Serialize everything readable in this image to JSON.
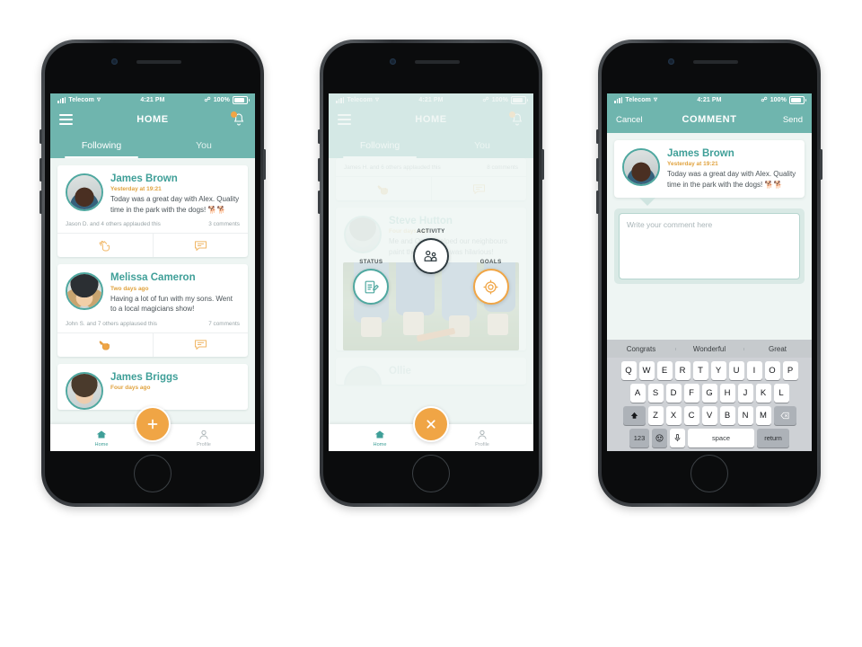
{
  "colors": {
    "teal": "#6fb5ae",
    "teal_dark": "#3f9f98",
    "orange": "#f0a545",
    "bg": "#eef5f3",
    "text": "#4a5358"
  },
  "status_bar": {
    "carrier": "Telecom",
    "time": "4:21 PM",
    "battery_pct": "100%",
    "signal_icon": "signal-bars-icon",
    "wifi_icon": "wifi-icon",
    "bluetooth_icon": "bluetooth-icon",
    "battery_icon": "battery-icon"
  },
  "phone1": {
    "nav": {
      "title": "HOME",
      "menu_icon": "hamburger-menu-icon",
      "bell_icon": "notification-bell-icon"
    },
    "tabs": [
      {
        "label": "Following",
        "active": true
      },
      {
        "label": "You",
        "active": false
      }
    ],
    "posts": [
      {
        "author": "James Brown",
        "time": "Yesterday at 19:21",
        "text": "Today was a great day with Alex. Quality time in the park with the dogs! 🐕🐕",
        "applause": "Jason D. and 4 others applauded this",
        "comments": "3 comments",
        "applaud_icon": "clapping-hands-icon",
        "comment_icon": "speech-bubble-icon"
      },
      {
        "author": "Melissa Cameron",
        "time": "Two days ago",
        "text": "Having a lot of fun with my sons. Went to a local magicians show!",
        "applause": "John S. and 7 others applaused this",
        "comments": "7 comments",
        "applaud_icon": "clapping-hands-icon",
        "comment_icon": "speech-bubble-icon"
      },
      {
        "author": "James Briggs",
        "time": "Four days ago",
        "text": "",
        "applause": "",
        "comments": "",
        "applaud_icon": "clapping-hands-icon",
        "comment_icon": "speech-bubble-icon"
      }
    ],
    "tabbar": {
      "home_label": "Home",
      "home_icon": "home-icon",
      "profile_label": "Profile",
      "profile_icon": "person-icon",
      "fab_icon": "plus-icon"
    }
  },
  "phone2": {
    "nav": {
      "title": "HOME",
      "menu_icon": "hamburger-menu-icon",
      "bell_icon": "notification-bell-icon"
    },
    "tabs": [
      {
        "label": "Following",
        "active": true
      },
      {
        "label": "You",
        "active": false
      }
    ],
    "top_post": {
      "applause": "James H. and 6 others applauded this",
      "comments": "8 comments",
      "applaud_icon": "clapping-hands-icon",
      "comment_icon": "speech-bubble-icon"
    },
    "post": {
      "author": "Steve Hutton",
      "time": "Four days ago",
      "text": "Me and Oscar helped our neighbours paint their fence. It was hilarious!"
    },
    "bottom_post_author": "Ollie",
    "action_menu": [
      {
        "label": "STATUS",
        "icon": "pencil-note-icon",
        "color": "#4fa8a0"
      },
      {
        "label": "ACTIVITY",
        "icon": "people-group-icon",
        "color": "#2f3b40"
      },
      {
        "label": "GOALS",
        "icon": "target-icon",
        "color": "#f0a545"
      }
    ],
    "tabbar": {
      "home_label": "Home",
      "home_icon": "home-icon",
      "profile_label": "Profile",
      "profile_icon": "person-icon",
      "fab_icon": "close-x-icon"
    }
  },
  "phone3": {
    "nav": {
      "cancel_label": "Cancel",
      "title": "COMMENT",
      "send_label": "Send"
    },
    "post": {
      "author": "James Brown",
      "time": "Yesterday at 19:21",
      "text": "Today was a great day with Alex. Quality time in the park with the dogs! 🐕🐕"
    },
    "comment_input": {
      "placeholder": "Write your comment here",
      "value": ""
    },
    "suggestions": [
      "Congrats",
      "Wonderful",
      "Great"
    ],
    "keyboard": {
      "row1": [
        "Q",
        "W",
        "E",
        "R",
        "T",
        "Y",
        "U",
        "I",
        "O",
        "P"
      ],
      "row2": [
        "A",
        "S",
        "D",
        "F",
        "G",
        "H",
        "J",
        "K",
        "L"
      ],
      "row3": [
        "Z",
        "X",
        "C",
        "V",
        "B",
        "N",
        "M"
      ],
      "shift_icon": "shift-arrow-icon",
      "backspace_icon": "backspace-icon",
      "numbers_label": "123",
      "emoji_icon": "smiley-face-icon",
      "mic_icon": "microphone-icon",
      "space_label": "space",
      "return_label": "return"
    }
  }
}
